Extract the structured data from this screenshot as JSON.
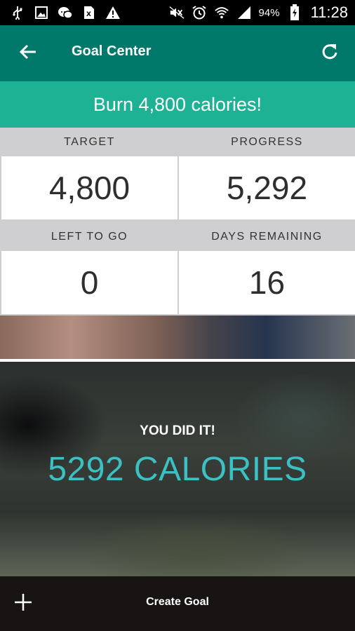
{
  "status_bar": {
    "battery": "94%",
    "time": "11:28",
    "icons_left": [
      "usb-icon",
      "image-icon",
      "chat-icon",
      "excel-icon",
      "warning-icon"
    ],
    "icons_right": [
      "mute-icon",
      "alarm-icon",
      "wifi-icon",
      "signal-icon",
      "battery-icon"
    ]
  },
  "app_bar": {
    "title": "Goal Center",
    "back_icon": "arrow-left-icon",
    "refresh_icon": "refresh-icon"
  },
  "goal": {
    "banner": "Burn 4,800 calories!"
  },
  "stats": {
    "target_label": "TARGET",
    "target_value": "4,800",
    "progress_label": "PROGRESS",
    "progress_value": "5,292",
    "left_label": "LEFT TO GO",
    "left_value": "0",
    "days_label": "DAYS REMAINING",
    "days_value": "16"
  },
  "achievement": {
    "headline": "YOU DID IT!",
    "calories": "5292 CALORIES"
  },
  "bottom_bar": {
    "create_label": "Create Goal",
    "add_icon": "plus-icon"
  },
  "colors": {
    "app_bar": "#00796b",
    "banner": "#1eb294",
    "accent": "#3bc0c3",
    "bottom_bar": "#181414"
  }
}
